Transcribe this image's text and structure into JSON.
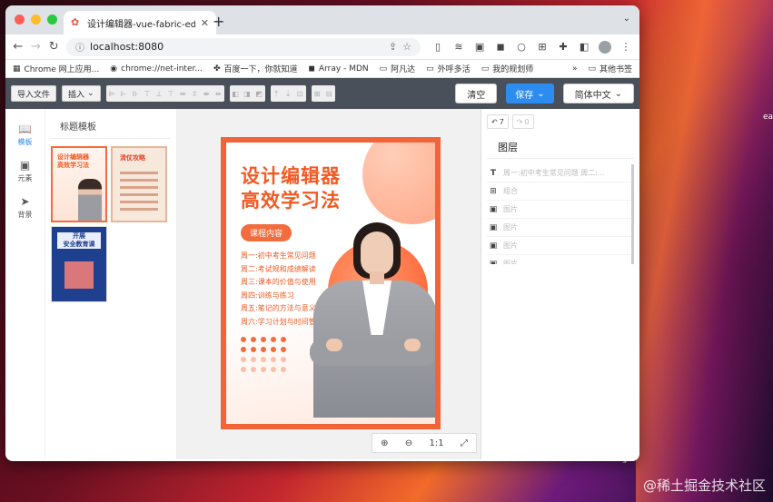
{
  "browser": {
    "tab_title": "设计编辑器-vue-fabric-editor",
    "url": "localhost:8080",
    "bookmarks": [
      {
        "icon": "apps-icon",
        "label": "Chrome 网上应用..."
      },
      {
        "icon": "chrome-icon",
        "label": "chrome://net-inter..."
      },
      {
        "icon": "baidu-icon",
        "label": "百度一下，你就知道"
      },
      {
        "icon": "mdn-icon",
        "label": "Array - MDN"
      },
      {
        "icon": "folder-icon",
        "label": "阿凡达"
      },
      {
        "icon": "folder-icon",
        "label": "外呼多活"
      },
      {
        "icon": "folder-icon",
        "label": "我的规划师"
      }
    ],
    "bookmarks_more": "»",
    "other_bookmarks": "其他书签"
  },
  "header": {
    "import_label": "导入文件",
    "insert_label": "插入",
    "clear_label": "清空",
    "save_label": "保存",
    "language_label": "简体中文"
  },
  "side_nav": [
    {
      "icon": "book-icon",
      "label": "模板",
      "active": true
    },
    {
      "icon": "image-icon",
      "label": "元素",
      "active": false
    },
    {
      "icon": "send-icon",
      "label": "背景",
      "active": false
    }
  ],
  "templates": {
    "title": "标题模板",
    "items": [
      {
        "title": "设计编辑器\n高效学习法"
      },
      {
        "title": "清仗攻略"
      },
      {
        "title": "开展\n安全教育课"
      }
    ]
  },
  "poster": {
    "headline_1": "设计编辑器",
    "headline_2": "高效学习法",
    "pill": "课程内容",
    "items": [
      "周一:初中考生常见问题",
      "周二:考试规和成绩解读",
      "周三:课本的价值与使用",
      "周四:训练与练习",
      "周五:笔记的方法与意义",
      "周六:学习计划与时间管理"
    ]
  },
  "zoom": {
    "zoom_in": "⊕",
    "zoom_out": "⊖",
    "ratio": "1:1",
    "fit": "⤢"
  },
  "history": {
    "undo_count": "7",
    "redo_count": "0"
  },
  "layers": {
    "title": "图层",
    "items": [
      {
        "icon": "text-icon",
        "label": "周一:初中考生常见问题 周二:..."
      },
      {
        "icon": "group-icon",
        "label": "组合"
      },
      {
        "icon": "image-icon",
        "label": "图片"
      },
      {
        "icon": "image-icon",
        "label": "图片"
      },
      {
        "icon": "image-icon",
        "label": "图片"
      },
      {
        "icon": "image-icon",
        "label": "图片"
      }
    ]
  },
  "desktop": {
    "watermark": "@稀土掘金技术社区",
    "edge_label": "ea"
  }
}
